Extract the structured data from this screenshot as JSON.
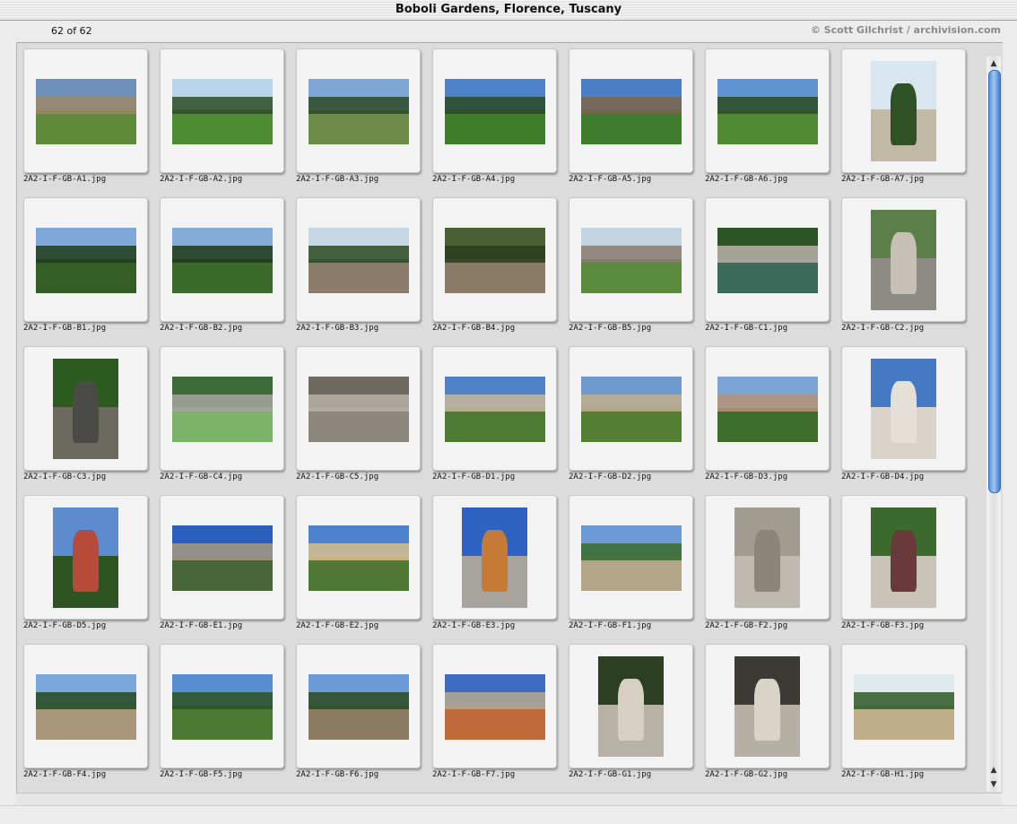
{
  "window": {
    "title": "Boboli Gardens, Florence, Tuscany"
  },
  "header": {
    "count": "62 of 62",
    "credit": "© Scott Gilchrist / archivision.com"
  },
  "images": [
    {
      "file": "2A2-I-F-GB-A1.jpg",
      "orient": "land",
      "sky": "#6d8fb8",
      "ground": "#5f8a3a",
      "accent": "#9b8a66"
    },
    {
      "file": "2A2-I-F-GB-A2.jpg",
      "orient": "land",
      "sky": "#b9d3ea",
      "ground": "#4c8b32",
      "accent": "#2b4d22"
    },
    {
      "file": "2A2-I-F-GB-A3.jpg",
      "orient": "land",
      "sky": "#7fa7d6",
      "ground": "#6c8a48",
      "accent": "#2c4a24"
    },
    {
      "file": "2A2-I-F-GB-A4.jpg",
      "orient": "land",
      "sky": "#4d82c8",
      "ground": "#3e7e2a",
      "accent": "#2d4a22"
    },
    {
      "file": "2A2-I-F-GB-A5.jpg",
      "orient": "land",
      "sky": "#4b7fc6",
      "ground": "#3d7d2d",
      "accent": "#7d6548"
    },
    {
      "file": "2A2-I-F-GB-A6.jpg",
      "orient": "land",
      "sky": "#5f93d2",
      "ground": "#4f8a33",
      "accent": "#2c4a20"
    },
    {
      "file": "2A2-I-F-GB-A7.jpg",
      "orient": "port",
      "sky": "#d8e6ef",
      "ground": "#c2b9a5",
      "accent": "#2f5126"
    },
    {
      "file": "2A2-I-F-GB-B1.jpg",
      "orient": "land",
      "sky": "#7fa9da",
      "ground": "#345e26",
      "accent": "#1f3d18"
    },
    {
      "file": "2A2-I-F-GB-B2.jpg",
      "orient": "land",
      "sky": "#83acd8",
      "ground": "#3c6a2a",
      "accent": "#1f3a17"
    },
    {
      "file": "2A2-I-F-GB-B3.jpg",
      "orient": "land",
      "sky": "#c6d7e6",
      "ground": "#8c7c6b",
      "accent": "#2c4b22"
    },
    {
      "file": "2A2-I-F-GB-B4.jpg",
      "orient": "land",
      "sky": "#4a5f34",
      "ground": "#8a7a66",
      "accent": "#2b3c1e"
    },
    {
      "file": "2A2-I-F-GB-B5.jpg",
      "orient": "land",
      "sky": "#c2d3e2",
      "ground": "#5a8b3e",
      "accent": "#8a7d70"
    },
    {
      "file": "2A2-I-F-GB-C1.jpg",
      "orient": "land",
      "sky": "#2d5424",
      "ground": "#3a6a5a",
      "accent": "#b8b2a8"
    },
    {
      "file": "2A2-I-F-GB-C2.jpg",
      "orient": "port",
      "sky": "#5c7f4a",
      "ground": "#8e8a84",
      "accent": "#c6c0b6"
    },
    {
      "file": "2A2-I-F-GB-C3.jpg",
      "orient": "port",
      "sky": "#2d5a1f",
      "ground": "#6c6a5e",
      "accent": "#4a4a46"
    },
    {
      "file": "2A2-I-F-GB-C4.jpg",
      "orient": "land",
      "sky": "#3e6a3a",
      "ground": "#7cb46a",
      "accent": "#a7a39c"
    },
    {
      "file": "2A2-I-F-GB-C5.jpg",
      "orient": "land",
      "sky": "#6e6a62",
      "ground": "#8c877e",
      "accent": "#b6b0a6"
    },
    {
      "file": "2A2-I-F-GB-D1.jpg",
      "orient": "land",
      "sky": "#4f82c6",
      "ground": "#4e7c34",
      "accent": "#c9b99a"
    },
    {
      "file": "2A2-I-F-GB-D2.jpg",
      "orient": "land",
      "sky": "#6f9ad0",
      "ground": "#557f35",
      "accent": "#bfae8a"
    },
    {
      "file": "2A2-I-F-GB-D3.jpg",
      "orient": "land",
      "sky": "#7aa3d6",
      "ground": "#3f6e2c",
      "accent": "#b99475"
    },
    {
      "file": "2A2-I-F-GB-D4.jpg",
      "orient": "port",
      "sky": "#4679c4",
      "ground": "#d8d4cc",
      "accent": "#e4e0d8"
    },
    {
      "file": "2A2-I-F-GB-D5.jpg",
      "orient": "port",
      "sky": "#5c8bd0",
      "ground": "#2f5424",
      "accent": "#b84a3a"
    },
    {
      "file": "2A2-I-F-GB-E1.jpg",
      "orient": "land",
      "sky": "#2a5fc0",
      "ground": "#46663a",
      "accent": "#a6987f"
    },
    {
      "file": "2A2-I-F-GB-E2.jpg",
      "orient": "land",
      "sky": "#4d83cc",
      "ground": "#4e7834",
      "accent": "#d8c08a"
    },
    {
      "file": "2A2-I-F-GB-E3.jpg",
      "orient": "port",
      "sky": "#2e62c2",
      "ground": "#a7a49e",
      "accent": "#c77a35"
    },
    {
      "file": "2A2-I-F-GB-F1.jpg",
      "orient": "land",
      "sky": "#6b9ad4",
      "ground": "#b4a688",
      "accent": "#3b6a2a"
    },
    {
      "file": "2A2-I-F-GB-F2.jpg",
      "orient": "port",
      "sky": "#a19b90",
      "ground": "#bfbab0",
      "accent": "#8c857a"
    },
    {
      "file": "2A2-I-F-GB-F3.jpg",
      "orient": "port",
      "sky": "#3c6a2c",
      "ground": "#c9c3b8",
      "accent": "#6a3a3a"
    },
    {
      "file": "2A2-I-F-GB-F4.jpg",
      "orient": "land",
      "sky": "#7aa8da",
      "ground": "#a9977b",
      "accent": "#264a1f"
    },
    {
      "file": "2A2-I-F-GB-F5.jpg",
      "orient": "land",
      "sky": "#5a8ed2",
      "ground": "#4d7a32",
      "accent": "#2f5226"
    },
    {
      "file": "2A2-I-F-GB-F6.jpg",
      "orient": "land",
      "sky": "#6b9ad6",
      "ground": "#8a7a62",
      "accent": "#2c4a22"
    },
    {
      "file": "2A2-I-F-GB-F7.jpg",
      "orient": "land",
      "sky": "#3d6cc0",
      "ground": "#c06a3a",
      "accent": "#b5a98f"
    },
    {
      "file": "2A2-I-F-GB-G1.jpg",
      "orient": "port",
      "sky": "#2b4022",
      "ground": "#b8b2a6",
      "accent": "#d6d0c4"
    },
    {
      "file": "2A2-I-F-GB-G2.jpg",
      "orient": "port",
      "sky": "#3c3a34",
      "ground": "#b5afa4",
      "accent": "#d9d3c8"
    },
    {
      "file": "2A2-I-F-GB-H1.jpg",
      "orient": "land",
      "sky": "#dfe9ee",
      "ground": "#c0ad8c",
      "accent": "#2e5a26"
    }
  ],
  "scrollbar": {
    "position": 0.0,
    "visible_fraction": 0.58
  }
}
